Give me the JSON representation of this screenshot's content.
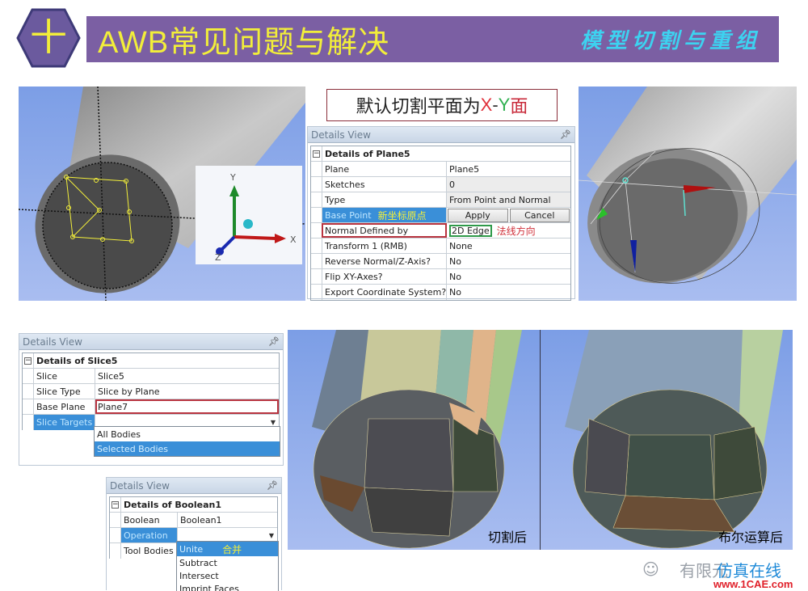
{
  "header": {
    "badge_char": "十",
    "title": "AWB常见问题与解决",
    "subtitle": "模型切割与重组",
    "colors": {
      "bar": "#7b5fa3",
      "title": "#f2ee3a",
      "subtitle": "#3dd2f0"
    }
  },
  "callout": {
    "prefix": "默认切割平面为",
    "x": "X",
    "dash": "-",
    "y": "Y",
    "suffix": "面"
  },
  "triad": {
    "x_label": "X",
    "y_label": "Y",
    "z_label": "Z"
  },
  "plane_panel": {
    "title": "Details View",
    "pin": "ᵖ",
    "section": "Details of Plane5",
    "rows": [
      {
        "key": "Plane",
        "value": "Plane5"
      },
      {
        "key": "Sketches",
        "value": "0"
      },
      {
        "key": "Type",
        "value": "From Point and Normal"
      },
      {
        "key": "Base Point",
        "annotation": "新坐标原点",
        "apply": "Apply",
        "cancel": "Cancel"
      },
      {
        "key": "Normal Defined by",
        "value": "2D Edge",
        "annotation": "法线方向"
      },
      {
        "key": "Transform 1 (RMB)",
        "value": "None"
      },
      {
        "key": "Reverse Normal/Z-Axis?",
        "value": "No"
      },
      {
        "key": "Flip XY-Axes?",
        "value": "No"
      },
      {
        "key": "Export Coordinate System?",
        "value": "No"
      }
    ]
  },
  "slice_panel": {
    "title": "Details View",
    "section": "Details of Slice5",
    "rows": [
      {
        "key": "Slice",
        "value": "Slice5"
      },
      {
        "key": "Slice Type",
        "value": "Slice by Plane"
      },
      {
        "key": "Base Plane",
        "value": "Plane7"
      },
      {
        "key": "Slice Targets",
        "value": ""
      }
    ],
    "dropdown_options": [
      "All Bodies",
      "Selected Bodies"
    ],
    "dropdown_selected": "Selected Bodies"
  },
  "boolean_panel": {
    "title": "Details View",
    "section": "Details of Boolean1",
    "rows": [
      {
        "key": "Boolean",
        "value": "Boolean1"
      },
      {
        "key": "Operation",
        "value": ""
      },
      {
        "key": "Tool Bodies",
        "value": ""
      }
    ],
    "dropdown_options": [
      "Unite",
      "Subtract",
      "Intersect",
      "Imprint Faces"
    ],
    "dropdown_selected": "Unite",
    "unite_annotation": "合并"
  },
  "result_labels": {
    "after_slice": "切割后",
    "after_boolean": "布尔运算后"
  },
  "watermark": {
    "text_grey": "有限元",
    "text_blue": "仿真在线",
    "url": "www.1CAE.com"
  }
}
